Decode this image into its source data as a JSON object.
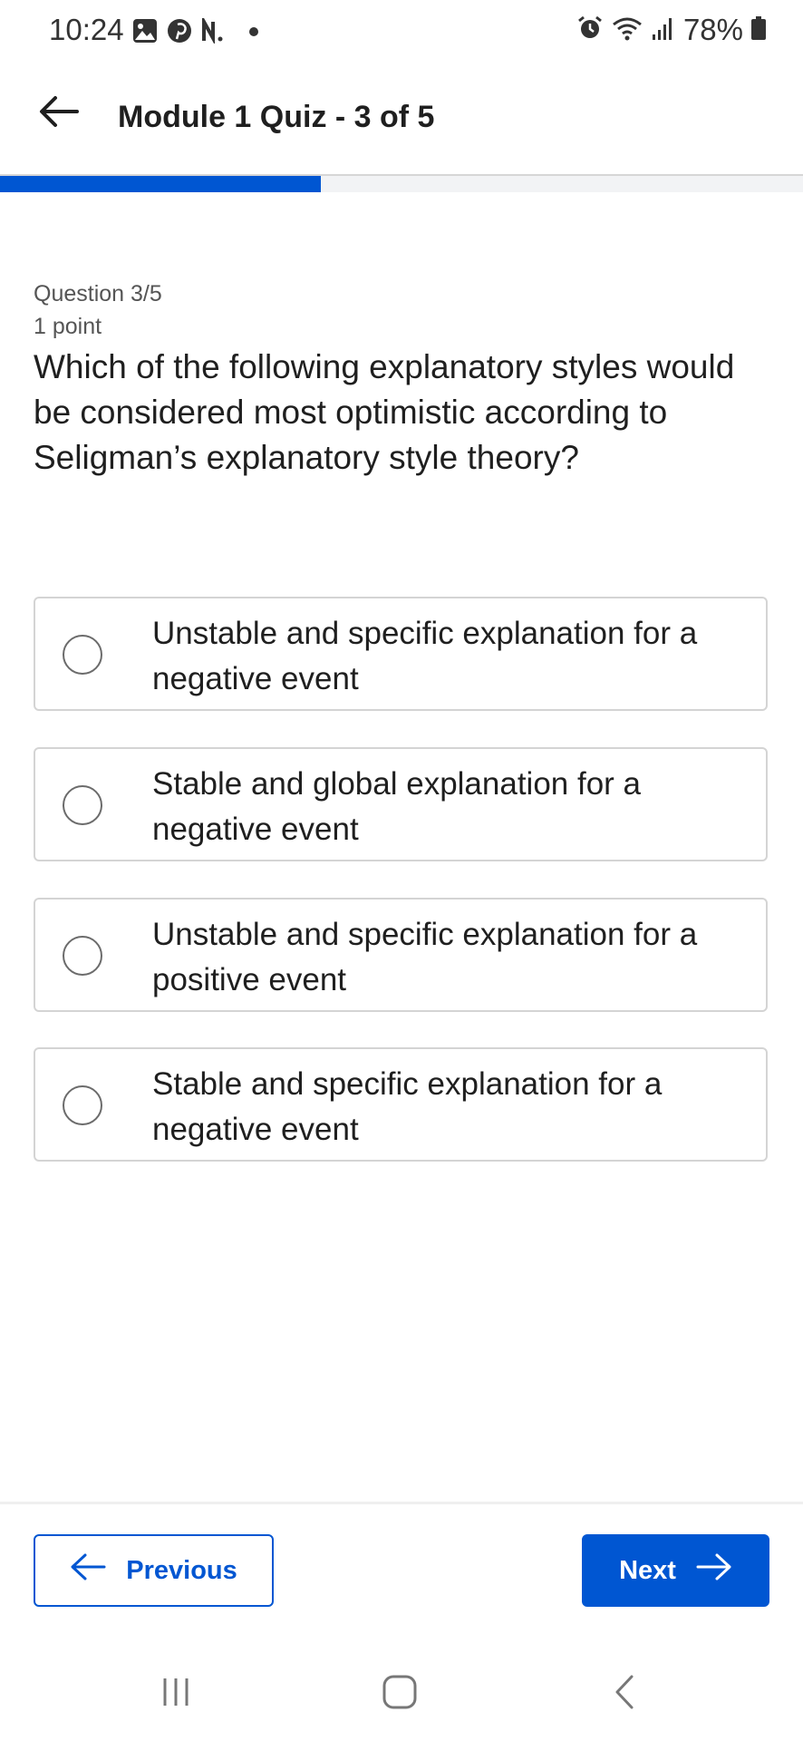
{
  "status_bar": {
    "time": "10:24",
    "notification_icons": [
      "image-icon",
      "pinterest-icon",
      "netflix-icon",
      "dot-icon"
    ],
    "system_icons": [
      "alarm-icon",
      "wifi-icon",
      "signal-icon",
      "battery-icon"
    ],
    "battery": "78%"
  },
  "header": {
    "title": "Module 1 Quiz - 3 of 5",
    "back_icon": "arrow-left-icon"
  },
  "progress": {
    "fraction": 0.4,
    "color": "#0056d2"
  },
  "question": {
    "number_label": "Question 3/5",
    "points_label": "1 point",
    "text": "Which of the following explanatory styles would be considered most optimistic according to Seligman’s explanatory style theory?"
  },
  "options": [
    {
      "label": "Unstable and specific explanation for a negative event",
      "selected": false
    },
    {
      "label": "Stable and global explanation for a negative event",
      "selected": false
    },
    {
      "label": "Unstable and specific explanation for a positive event",
      "selected": false
    },
    {
      "label": "Stable and specific explanation for a negative event",
      "selected": false
    }
  ],
  "footer": {
    "previous_label": "Previous",
    "next_label": "Next"
  },
  "nav_bar": {
    "icons": [
      "recent-apps-icon",
      "home-icon",
      "back-icon"
    ]
  },
  "colors": {
    "accent": "#0056d2",
    "border": "#d4d4d4"
  }
}
